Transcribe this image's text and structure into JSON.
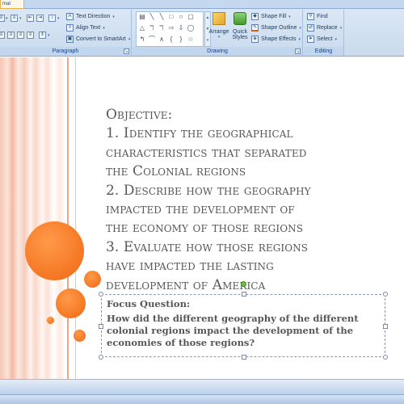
{
  "ribbon": {
    "active_tab": "mat",
    "paragraph": {
      "label": "Paragraph",
      "text_direction": "Text Direction",
      "align_text": "Align Text",
      "convert_smartart": "Convert to SmartArt"
    },
    "drawing": {
      "label": "Drawing",
      "arrange": "Arrange",
      "quick_styles_line1": "Quick",
      "quick_styles_line2": "Styles",
      "shape_fill": "Shape Fill",
      "shape_outline": "Shape Outline",
      "shape_effects": "Shape Effects"
    },
    "editing": {
      "label": "Editing",
      "find": "Find",
      "replace": "Replace",
      "select": "Select"
    }
  },
  "slide": {
    "objective_lines": [
      "Objective:",
      "1.  Identify the geographical",
      "characteristics that separated",
      "the Colonial regions",
      "2.  Describe how the geography",
      "impacted the development of",
      "the economy of those regions",
      "3.  Evaluate how those regions",
      "have impacted the lasting",
      "development of America"
    ],
    "focus_title": "Focus Question:",
    "focus_body": "How did the different geography of the different colonial regions impact the development of the economies of those regions?"
  },
  "colors": {
    "accent_orange": "#f57622",
    "text_gray": "#55575a",
    "ribbon_blue": "#c9dbee"
  }
}
